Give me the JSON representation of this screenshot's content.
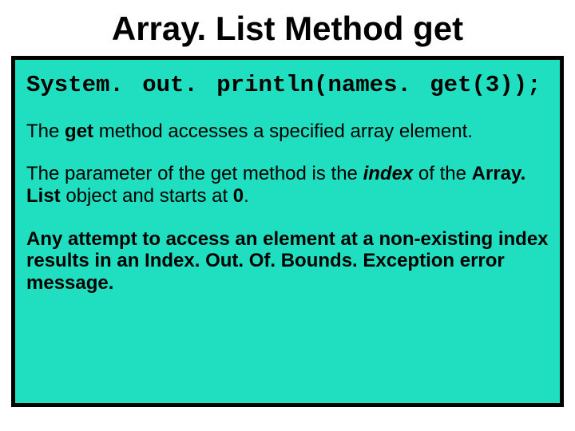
{
  "title": "Array. List Method get",
  "code": "System. out. println(names. get(3));",
  "para1": {
    "pre": "The ",
    "get": "get",
    "post": " method accesses a specified array element."
  },
  "para2": {
    "a": "The parameter of the get method is the ",
    "index": "index",
    "b": " of the ",
    "arraylist": "Array. List",
    "c": " object and starts at ",
    "zero": "0",
    "d": "."
  },
  "para3": {
    "a": "Any attempt to access an element at a non-existing index results in an ",
    "exc": "Index. Out. Of. Bounds. Exception",
    "b": " error message."
  }
}
